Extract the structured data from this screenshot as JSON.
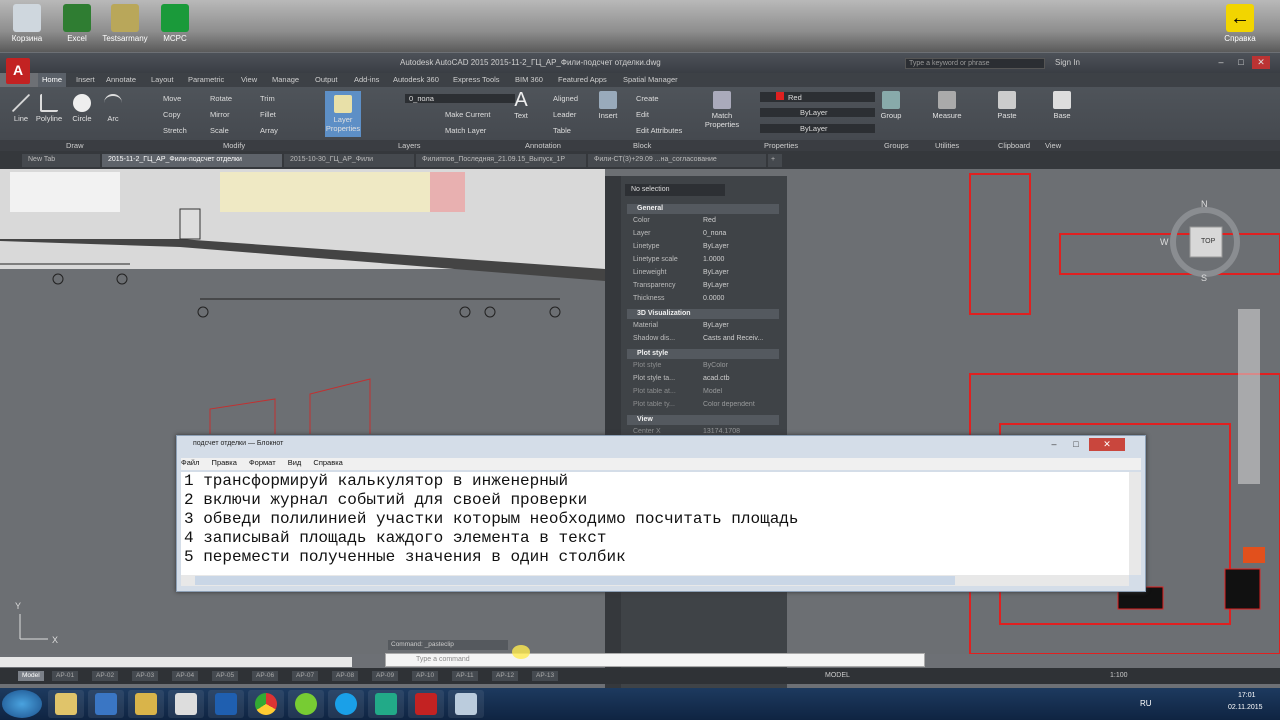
{
  "desktop": {
    "icons": [
      {
        "label": "Корзина"
      },
      {
        "label": "Excel"
      },
      {
        "label": "Testsarmany"
      },
      {
        "label": "MCPC"
      }
    ],
    "right_icon_label": "Справка"
  },
  "window": {
    "title": "Autodesk AutoCAD 2015   2015-11-2_ГЦ_АР_Фили-подсчет отделки.dwg",
    "search_placeholder": "Type a keyword or phrase",
    "sign_in": "Sign In",
    "logo_letter": "A"
  },
  "ribbon_tabs": [
    "Home",
    "Insert",
    "Annotate",
    "Layout",
    "Parametric",
    "View",
    "Manage",
    "Output",
    "Add-ins",
    "Autodesk 360",
    "Express Tools",
    "BIM 360",
    "Featured Apps",
    "Spatial Manager"
  ],
  "ribbon": {
    "draw": [
      "Line",
      "Polyline",
      "Circle",
      "Arc"
    ],
    "modify": [
      [
        "Move",
        "Rotate",
        "Trim"
      ],
      [
        "Copy",
        "Mirror",
        "Fillet"
      ],
      [
        "Stretch",
        "Scale",
        "Array"
      ]
    ],
    "layer_properties": "Layer Properties",
    "layer_name": "0_пола",
    "layers_small": [
      "Make Current",
      "Match Layer"
    ],
    "annotation": [
      "Text",
      "Aligned",
      "Leader",
      "Table"
    ],
    "block": [
      "Insert",
      "Create",
      "Edit",
      "Edit Attributes"
    ],
    "match_properties": "Match Properties",
    "prop_color": "Red",
    "prop_linetype": "ByLayer",
    "prop_lineweight": "ByLayer",
    "others": [
      "Group",
      "Measure",
      "Paste",
      "Base"
    ],
    "panels": [
      "Draw",
      "Modify",
      "Layers",
      "Annotation",
      "Block",
      "Properties",
      "Groups",
      "Utilities",
      "Clipboard",
      "View"
    ]
  },
  "doc_tabs": [
    "New Tab",
    "2015-11-2_ГЦ_АР_Фили-подсчет отделки",
    "2015-10-30_ГЦ_АР_Фили",
    "Филиппов_Последняя_21.09.15_Выпуск_1Р",
    "Фили-СТ(3)+29.09 ...на_согласование"
  ],
  "properties": {
    "selection": "No selection",
    "sections": [
      {
        "name": "General",
        "rows": [
          [
            "Color",
            "Red"
          ],
          [
            "Layer",
            "0_пола"
          ],
          [
            "Linetype",
            "ByLayer"
          ],
          [
            "Linetype scale",
            "1.0000"
          ],
          [
            "Lineweight",
            "ByLayer"
          ],
          [
            "Transparency",
            "ByLayer"
          ],
          [
            "Thickness",
            "0.0000"
          ]
        ]
      },
      {
        "name": "3D Visualization",
        "rows": [
          [
            "Material",
            "ByLayer"
          ],
          [
            "Shadow dis...",
            "Casts and Receiv..."
          ]
        ]
      },
      {
        "name": "Plot style",
        "rows": [
          [
            "Plot style",
            "ByColor"
          ],
          [
            "Plot style ta...",
            "acad.ctb"
          ],
          [
            "Plot table at...",
            "Model"
          ],
          [
            "Plot table ty...",
            "Color dependent"
          ]
        ]
      },
      {
        "name": "View",
        "rows": [
          [
            "Center X",
            "13174.1708"
          ]
        ]
      }
    ],
    "colors": {
      "red": "#e02020"
    }
  },
  "notepad": {
    "title": "подсчет отделки — Блокнот",
    "menu": [
      "Файл",
      "Правка",
      "Формат",
      "Вид",
      "Справка"
    ],
    "lines": [
      "1 трансформируй калькулятор в инженерный",
      "2 включи журнал событий для своей проверки",
      "3 обведи полилинией участки которым необходимо посчитать площадь",
      "4 записывай площадь каждого элемента в текст",
      "5 перемести полученные значения в один столбик"
    ]
  },
  "command": {
    "history": "Command: _pasteclip",
    "placeholder": "Type a command"
  },
  "layout_tabs": [
    "Model",
    "АР-01",
    "АР-02",
    "АР-03",
    "АР-04",
    "АР-05",
    "АР-06",
    "АР-07",
    "АР-08",
    "АР-09",
    "АР-10",
    "АР-11",
    "АР-12",
    "АР-13"
  ],
  "status": {
    "mode": "MODEL",
    "scale": "1:100"
  },
  "viewcube": {
    "north": "N",
    "west": "W",
    "south": "S",
    "top": "TOP"
  },
  "taskbar": {
    "apps": [
      "explorer",
      "media-player",
      "outlook",
      "chrome",
      "utorrent",
      "skype",
      "autocad",
      "notepad"
    ],
    "clock_time": "17:01",
    "clock_date": "02.11.2015",
    "lang": "RU"
  }
}
